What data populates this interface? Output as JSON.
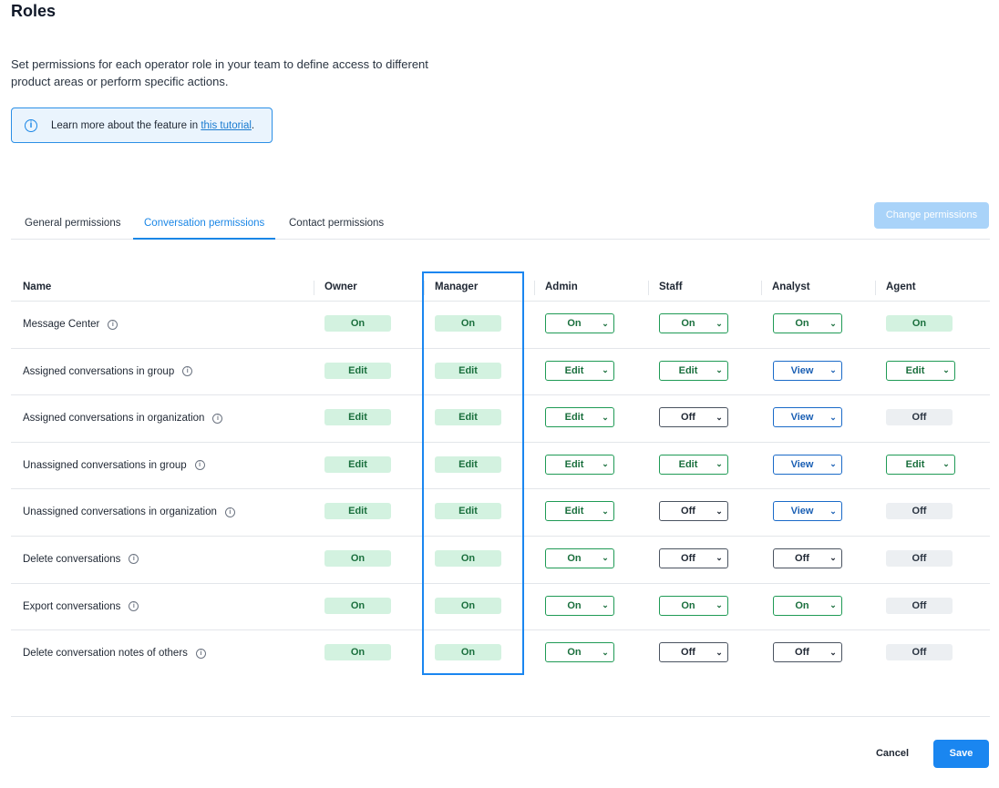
{
  "page": {
    "title": "Roles",
    "description": "Set permissions for each operator role in your team to define access to different product areas or perform specific actions."
  },
  "info": {
    "text": "Learn more about the feature in ",
    "link": "this tutorial",
    "suffix": ".",
    "icon": "info-icon"
  },
  "tabs": [
    {
      "label": "General permissions",
      "active": false
    },
    {
      "label": "Conversation permissions",
      "active": true
    },
    {
      "label": "Contact permissions",
      "active": false
    }
  ],
  "change_permissions_label": "Change permissions",
  "columns": [
    "Name",
    "Owner",
    "Manager",
    "Admin",
    "Staff",
    "Analyst",
    "Agent"
  ],
  "rows": [
    {
      "name": "Message Center",
      "cells": [
        {
          "v": "On",
          "t": "badge",
          "c": "green"
        },
        {
          "v": "On",
          "t": "badge",
          "c": "green"
        },
        {
          "v": "On",
          "t": "dd",
          "c": "green"
        },
        {
          "v": "On",
          "t": "dd",
          "c": "green"
        },
        {
          "v": "On",
          "t": "dd",
          "c": "green"
        },
        {
          "v": "On",
          "t": "badge",
          "c": "green"
        }
      ]
    },
    {
      "name": "Assigned conversations in group",
      "cells": [
        {
          "v": "Edit",
          "t": "badge",
          "c": "green"
        },
        {
          "v": "Edit",
          "t": "badge",
          "c": "green"
        },
        {
          "v": "Edit",
          "t": "dd",
          "c": "green"
        },
        {
          "v": "Edit",
          "t": "dd",
          "c": "green"
        },
        {
          "v": "View",
          "t": "dd",
          "c": "blue"
        },
        {
          "v": "Edit",
          "t": "dd",
          "c": "green"
        }
      ]
    },
    {
      "name": "Assigned conversations in organization",
      "cells": [
        {
          "v": "Edit",
          "t": "badge",
          "c": "green"
        },
        {
          "v": "Edit",
          "t": "badge",
          "c": "green"
        },
        {
          "v": "Edit",
          "t": "dd",
          "c": "green"
        },
        {
          "v": "Off",
          "t": "dd",
          "c": "dark"
        },
        {
          "v": "View",
          "t": "dd",
          "c": "blue"
        },
        {
          "v": "Off",
          "t": "badge",
          "c": "gray"
        }
      ]
    },
    {
      "name": "Unassigned conversations in group",
      "cells": [
        {
          "v": "Edit",
          "t": "badge",
          "c": "green"
        },
        {
          "v": "Edit",
          "t": "badge",
          "c": "green"
        },
        {
          "v": "Edit",
          "t": "dd",
          "c": "green"
        },
        {
          "v": "Edit",
          "t": "dd",
          "c": "green"
        },
        {
          "v": "View",
          "t": "dd",
          "c": "blue"
        },
        {
          "v": "Edit",
          "t": "dd",
          "c": "green"
        }
      ]
    },
    {
      "name": "Unassigned conversations in organization",
      "cells": [
        {
          "v": "Edit",
          "t": "badge",
          "c": "green"
        },
        {
          "v": "Edit",
          "t": "badge",
          "c": "green"
        },
        {
          "v": "Edit",
          "t": "dd",
          "c": "green"
        },
        {
          "v": "Off",
          "t": "dd",
          "c": "dark"
        },
        {
          "v": "View",
          "t": "dd",
          "c": "blue"
        },
        {
          "v": "Off",
          "t": "badge",
          "c": "gray"
        }
      ]
    },
    {
      "name": "Delete conversations",
      "cells": [
        {
          "v": "On",
          "t": "badge",
          "c": "green"
        },
        {
          "v": "On",
          "t": "badge",
          "c": "green"
        },
        {
          "v": "On",
          "t": "dd",
          "c": "green"
        },
        {
          "v": "Off",
          "t": "dd",
          "c": "dark"
        },
        {
          "v": "Off",
          "t": "dd",
          "c": "dark"
        },
        {
          "v": "Off",
          "t": "badge",
          "c": "gray"
        }
      ]
    },
    {
      "name": "Export conversations",
      "cells": [
        {
          "v": "On",
          "t": "badge",
          "c": "green"
        },
        {
          "v": "On",
          "t": "badge",
          "c": "green"
        },
        {
          "v": "On",
          "t": "dd",
          "c": "green"
        },
        {
          "v": "On",
          "t": "dd",
          "c": "green"
        },
        {
          "v": "On",
          "t": "dd",
          "c": "green"
        },
        {
          "v": "Off",
          "t": "badge",
          "c": "gray"
        }
      ]
    },
    {
      "name": "Delete conversation notes of others",
      "cells": [
        {
          "v": "On",
          "t": "badge",
          "c": "green"
        },
        {
          "v": "On",
          "t": "badge",
          "c": "green"
        },
        {
          "v": "On",
          "t": "dd",
          "c": "green"
        },
        {
          "v": "Off",
          "t": "dd",
          "c": "dark"
        },
        {
          "v": "Off",
          "t": "dd",
          "c": "dark"
        },
        {
          "v": "Off",
          "t": "badge",
          "c": "gray"
        }
      ]
    }
  ],
  "footer": {
    "cancel": "Cancel",
    "save": "Save"
  },
  "colors": {
    "accent": "#1a86f0",
    "green_bg": "#d3f2e0",
    "green_text": "#1a6f3d",
    "highlight": "#1a86f0"
  }
}
